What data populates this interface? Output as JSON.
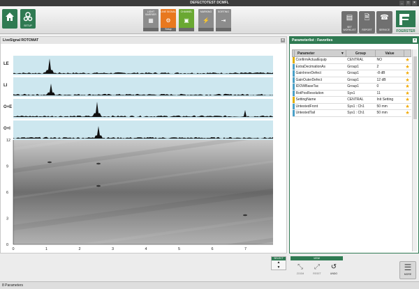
{
  "window": {
    "title": "DEFECTOTEST DCMFL",
    "controls": [
      "_",
      "□",
      "×"
    ]
  },
  "toolbar": {
    "home_label": "",
    "setup_label": "SETUP",
    "modes": [
      {
        "label": "LIGHT BARRIER",
        "footer": "",
        "icon": "▦"
      },
      {
        "label": "LINE SIGNAL",
        "footer": "Setup",
        "icon": "⚙"
      },
      {
        "label": "CHANNEL",
        "footer": "",
        "icon": "▣"
      },
      {
        "label": "MARKING",
        "footer": "",
        "icon": "⚡"
      },
      {
        "label": "SORTING",
        "footer": "",
        "icon": "⇥"
      }
    ],
    "right_buttons": [
      {
        "label": "SET WORKLIST",
        "icon": "▤"
      },
      {
        "label": "REPORT",
        "icon": "🗎"
      },
      {
        "label": "SERVICE",
        "icon": "☎"
      }
    ],
    "logo_text": "FOERSTER"
  },
  "left_panel": {
    "title": "LiveSignal ROTOMAT",
    "channels": [
      "LE",
      "LI",
      "O+E",
      "O+I"
    ],
    "yticks": [
      "12",
      "9",
      "6",
      "3",
      "0"
    ],
    "xticks": [
      "0",
      "1",
      "2",
      "3",
      "4",
      "5",
      "6",
      "7"
    ]
  },
  "right_panel": {
    "title": "Parameterlist : Favorites",
    "columns": [
      "Parameter",
      "Group",
      "Value"
    ],
    "rows": [
      {
        "name": "ConfirmActualEquip",
        "group": "CENTRAL",
        "value": "NO",
        "color": "#e0b000"
      },
      {
        "name": "ExtraDecimationAs",
        "group": "Group1",
        "value": "2",
        "color": "#4aa0c8"
      },
      {
        "name": "GainInnerDefect",
        "group": "Group1",
        "value": "-8 dB",
        "color": "#4aa0c8"
      },
      {
        "name": "GainOuterDefect",
        "group": "Group1",
        "value": "12 dB",
        "color": "#4aa0c8"
      },
      {
        "name": "IDOWBaseTac",
        "group": "Group1",
        "value": "0",
        "color": "#4aa0c8"
      },
      {
        "name": "RotPosResolution",
        "group": "Sys1",
        "value": "11",
        "color": "#4aa0c8"
      },
      {
        "name": "SettingName",
        "group": "CENTRAL",
        "value": "Init Setting",
        "color": "#e0b000"
      },
      {
        "name": "UntestedFront",
        "group": "Sys1 : Ch1",
        "value": "50 mm",
        "color": "#4aa0c8"
      },
      {
        "name": "UntestedTail",
        "group": "Sys1 : Ch1",
        "value": "50 mm",
        "color": "#4aa0c8"
      }
    ]
  },
  "bottom": {
    "select_label": "SELECT",
    "select_up": "▲",
    "select_down": "▼",
    "view_label": "VIEW",
    "nav_buttons": [
      {
        "label": "ZOOM",
        "icon": "⤡"
      },
      {
        "label": "RESET",
        "icon": "⤢"
      },
      {
        "label": "UNDO",
        "icon": "↺"
      }
    ],
    "more_label": "MORE",
    "status_text": "8 Parameters"
  },
  "colors": {
    "accent": "#2f7a52",
    "orange": "#e8781e",
    "star": "#f2a900"
  }
}
